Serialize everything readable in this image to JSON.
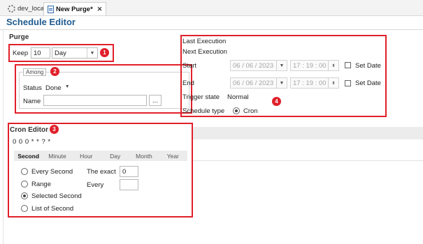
{
  "tabs": [
    {
      "label": "dev_local",
      "icon": "gear-icon"
    },
    {
      "label": "New Purge*",
      "icon": "document-icon",
      "close": "✕"
    }
  ],
  "page_title": "Schedule Editor",
  "purge": {
    "heading": "Purge",
    "keep_label": "Keep",
    "keep_value": "10",
    "unit_value": "Day",
    "among": {
      "legend": "Among",
      "status_label": "Status",
      "status_value": "Done",
      "name_label": "Name",
      "name_value": "",
      "browse_label": "..."
    }
  },
  "execution": {
    "last_label": "Last Execution",
    "next_label": "Next Execution",
    "start_label": "Start",
    "start_date": "06 / 06 / 2023",
    "start_time": "17 : 19 : 00",
    "end_label": "End",
    "end_date": "06 / 06 / 2023",
    "end_time": "17 : 19 : 00",
    "set_date_label": "Set Date",
    "trigger_label": "Trigger state",
    "trigger_value": "Normal",
    "schedule_type_label": "Schedule type",
    "schedule_type_value": "Cron"
  },
  "cron": {
    "heading": "Cron Editor",
    "expression": "0 0 0 * * ? *",
    "tabs": [
      "Second",
      "Minute",
      "Hour",
      "Day",
      "Month",
      "Year"
    ],
    "active_tab": "Second",
    "options": [
      "Every Second",
      "Range",
      "Selected Second",
      "List of Second"
    ],
    "selected_option": "Selected Second",
    "exact_label": "The exact",
    "exact_value": "0",
    "every_label": "Every",
    "every_value": ""
  },
  "badges": [
    "1",
    "2",
    "3",
    "4"
  ],
  "colors": {
    "annotation_red": "#e0202a",
    "title_blue": "#1f5b8f"
  }
}
